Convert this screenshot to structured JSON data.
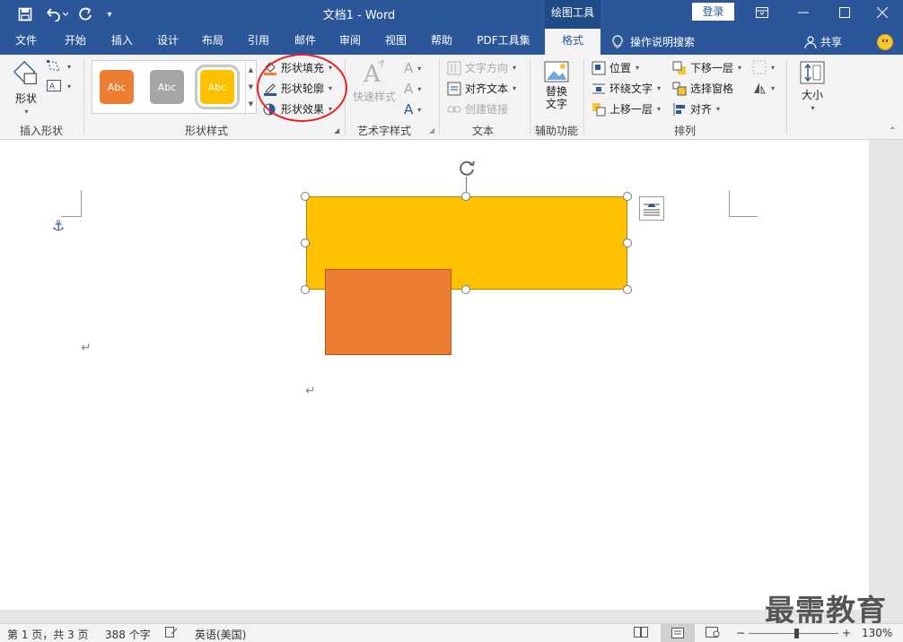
{
  "titlebar": {
    "save_icon": "save-icon",
    "undo_icon": "undo-icon",
    "redo_icon": "redo-icon",
    "customize_icon": "customize-quick-access-icon",
    "title": "文档1  -  Word",
    "context_label": "绘图工具",
    "login": "登录"
  },
  "tabs": {
    "file": "文件",
    "home": "开始",
    "insert": "插入",
    "design": "设计",
    "layout": "布局",
    "references": "引用",
    "mailings": "邮件",
    "review": "审阅",
    "view": "视图",
    "help": "帮助",
    "pdf": "PDF工具集",
    "format": "格式",
    "tell_me": "操作说明搜索",
    "share": "共享"
  },
  "ribbon": {
    "insert_shapes": {
      "shapes_label": "形状",
      "group_label": "插入形状"
    },
    "shape_styles": {
      "swatches": [
        {
          "label": "Abc",
          "color": "#ed7d31"
        },
        {
          "label": "Abc",
          "color": "#a5a5a5"
        },
        {
          "label": "Abc",
          "color": "#ffc000"
        }
      ],
      "fill": "形状填充",
      "outline": "形状轮廓",
      "effects": "形状效果",
      "group_label": "形状样式"
    },
    "wordart": {
      "quick_styles": "快速样式",
      "group_label": "艺术字样式"
    },
    "text": {
      "direction": "文字方向",
      "align": "对齐文本",
      "link": "创建链接",
      "group_label": "文本"
    },
    "accessibility": {
      "alt_text_line1": "替换",
      "alt_text_line2": "文字",
      "group_label": "辅助功能"
    },
    "arrange": {
      "position": "位置",
      "wrap": "环绕文字",
      "bring_forward": "上移一层",
      "send_backward": "下移一层",
      "selection_pane": "选择窗格",
      "align": "对齐",
      "group_label": "排列"
    },
    "size": {
      "label": "大小"
    }
  },
  "status": {
    "page": "第 1 页，共 3 页",
    "words": "388 个字",
    "language": "英语(美国)",
    "zoom": "130%"
  },
  "watermark": "最需教育",
  "colors": {
    "title_blue": "#2b579a",
    "shape_yellow": "#ffc000",
    "shape_orange": "#ed7d31",
    "annotation_red": "#e8222a"
  }
}
